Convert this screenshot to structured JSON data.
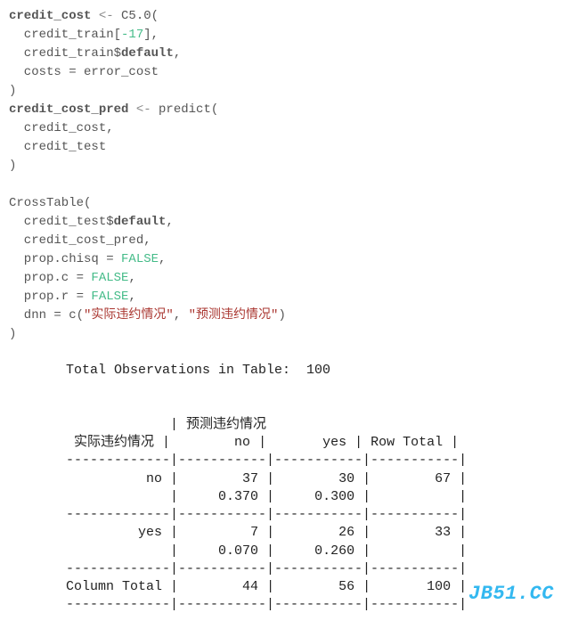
{
  "code": {
    "l1a": "credit_cost",
    "l1b": " <- ",
    "l1c": "C5.0(",
    "l2a": "  credit_train[",
    "l2b": "-17",
    "l2c": "],",
    "l3a": "  credit_train$",
    "l3b": "default",
    "l3c": ",",
    "l4": "  costs = error_cost",
    "l5": ")",
    "l6a": "credit_cost_pred",
    "l6b": " <- ",
    "l6c": "predict(",
    "l7": "  credit_cost,",
    "l8": "  credit_test",
    "l9": ")",
    "l10": "",
    "l11": "CrossTable(",
    "l12a": "  credit_test$",
    "l12b": "default",
    "l12c": ",",
    "l13": "  credit_cost_pred,",
    "l14a": "  prop.chisq = ",
    "l14b": "FALSE",
    "l14c": ",",
    "l15a": "  prop.c = ",
    "l15b": "FALSE",
    "l15c": ",",
    "l16a": "  prop.r = ",
    "l16b": "FALSE",
    "l16c": ",",
    "l17a": "  dnn = c(",
    "l17b": "\"实际违约情况\"",
    "l17c": ", ",
    "l17d": "\"预测违约情况\"",
    "l17e": ")",
    "l18": ")"
  },
  "output": {
    "title": "Total Observations in Table:  100",
    "header_col": "预测违约情况",
    "row_label": "实际违约情况",
    "col_no": "no",
    "col_yes": "yes",
    "col_total": "Row Total",
    "row1_label": "no",
    "row1_no": "37",
    "row1_yes": "30",
    "row1_total": "67",
    "row1_no_p": "0.370",
    "row1_yes_p": "0.300",
    "row2_label": "yes",
    "row2_no": "7",
    "row2_yes": "26",
    "row2_total": "33",
    "row2_no_p": "0.070",
    "row2_yes_p": "0.260",
    "coltotal_label": "Column Total",
    "coltotal_no": "44",
    "coltotal_yes": "56",
    "coltotal_total": "100",
    "sep": "-------------|-----------|-----------|-----------|",
    "hsep": "             | "
  },
  "watermark": "JB51.CC",
  "chart_data": {
    "type": "table",
    "title": "Total Observations in Table: 100",
    "row_dimension": "实际违约情况",
    "col_dimension": "预测违约情况",
    "columns": [
      "no",
      "yes",
      "Row Total"
    ],
    "rows": [
      {
        "label": "no",
        "no": 37,
        "yes": 30,
        "row_total": 67,
        "no_prop": 0.37,
        "yes_prop": 0.3
      },
      {
        "label": "yes",
        "no": 7,
        "yes": 26,
        "row_total": 33,
        "no_prop": 0.07,
        "yes_prop": 0.26
      }
    ],
    "column_total": {
      "no": 44,
      "yes": 56,
      "total": 100
    }
  }
}
